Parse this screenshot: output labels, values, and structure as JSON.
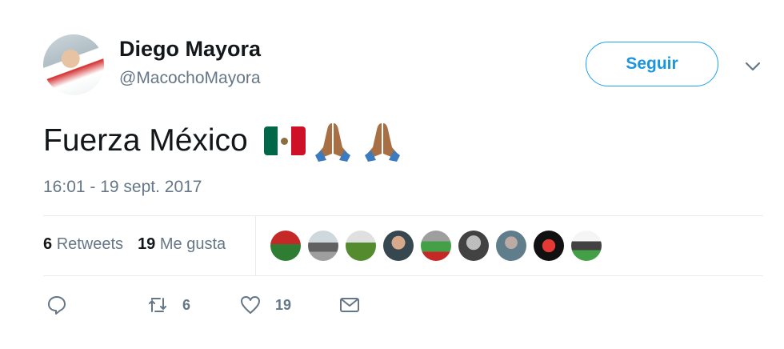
{
  "user": {
    "name": "Diego Mayora",
    "handle": "@MacochoMayora",
    "follow_label": "Seguir"
  },
  "tweet": {
    "text": "Fuerza México",
    "timestamp": "16:01 - 19 sept. 2017"
  },
  "stats": {
    "retweets_count": "6",
    "retweets_label": "Retweets",
    "likes_count": "19",
    "likes_label": "Me gusta"
  },
  "actions": {
    "retweet_count": "6",
    "like_count": "19"
  },
  "icons": [
    "caret-down-icon",
    "reply-icon",
    "retweet-icon",
    "heart-icon",
    "message-icon",
    "mexico-flag-icon",
    "folded-hands-icon"
  ],
  "colors": {
    "accent": "#1da1f2",
    "muted": "#657786",
    "text": "#14171a"
  }
}
